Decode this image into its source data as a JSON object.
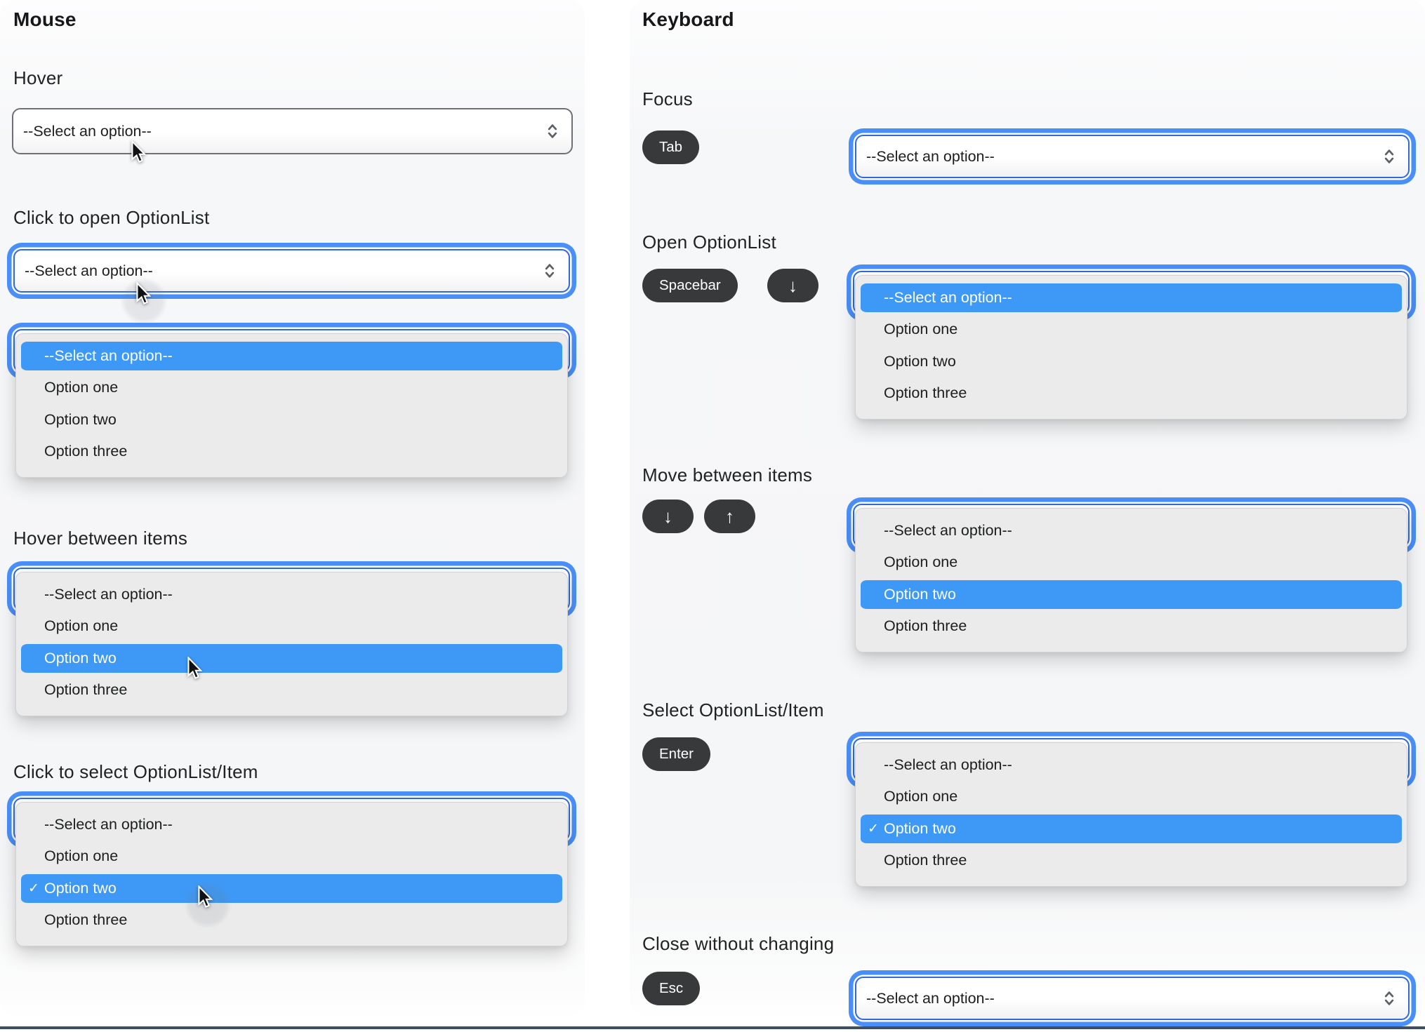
{
  "headings": {
    "mouse": "Mouse",
    "keyboard": "Keyboard"
  },
  "labels": {
    "hover": "Hover",
    "click_open": "Click to open OptionList",
    "hover_items": "Hover between items",
    "click_select": "Click to select OptionList/Item",
    "focus": "Focus",
    "open": "Open OptionList",
    "move": "Move between items",
    "select_item": "Select OptionList/Item",
    "close": "Close without changing"
  },
  "keys": {
    "tab": "Tab",
    "spacebar": "Spacebar",
    "down": "↓",
    "up": "↑",
    "enter": "Enter",
    "esc": "Esc"
  },
  "select": {
    "placeholder": "--Select an option--"
  },
  "options": {
    "placeholder": "--Select an option--",
    "one": "Option one",
    "two": "Option two",
    "three": "Option three"
  },
  "checkmark": "✓",
  "colors": {
    "highlight": "#3E99F6",
    "focus_ring": "#4A8FF7",
    "focus_border": "#2F6AD8",
    "select_border": "#6F7075",
    "panel": "#EBEBEB",
    "badge": "#38393B",
    "bottom_rule": "#3F4F63"
  }
}
